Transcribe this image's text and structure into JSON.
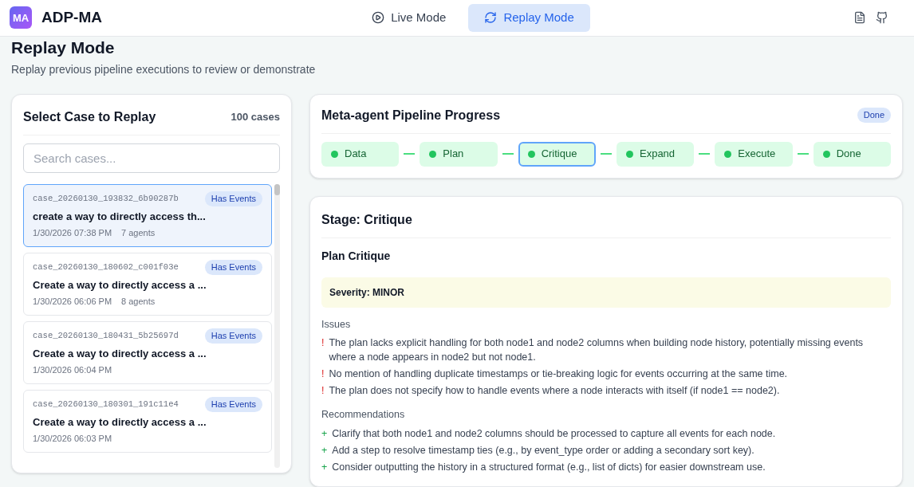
{
  "app": {
    "logo": "MA",
    "name": "ADP-MA"
  },
  "modes": [
    {
      "label": "Live Mode",
      "kind": "live",
      "selected": false
    },
    {
      "label": "Replay Mode",
      "kind": "replay",
      "selected": true
    }
  ],
  "page": {
    "title": "Replay Mode",
    "subtitle": "Replay previous pipeline executions to review or demonstrate"
  },
  "cases_panel": {
    "title": "Select Case to Replay",
    "count": "100 cases",
    "search": {
      "placeholder": "Search cases..."
    },
    "cases": [
      {
        "id": "case_20260130_193832_6b90287b",
        "badge": "Has Events",
        "title": "create a way to directly access th...",
        "time": "1/30/2026 07:38 PM",
        "agents": "7 agents",
        "selected": true
      },
      {
        "id": "case_20260130_180602_c001f03e",
        "badge": "Has Events",
        "title": "Create a way to directly access a ...",
        "time": "1/30/2026 06:06 PM",
        "agents": "8 agents",
        "selected": false
      },
      {
        "id": "case_20260130_180431_5b25697d",
        "badge": "Has Events",
        "title": "Create a way to directly access a ...",
        "time": "1/30/2026 06:04 PM",
        "selected": false
      },
      {
        "id": "case_20260130_180301_191c11e4",
        "badge": "Has Events",
        "title": "Create a way to directly access a ...",
        "time": "1/30/2026 06:03 PM",
        "selected": false
      }
    ]
  },
  "pipeline": {
    "title": "Meta-agent Pipeline Progress",
    "status": "Done",
    "stages": [
      {
        "label": "Data",
        "selected": false
      },
      {
        "label": "Plan",
        "selected": false
      },
      {
        "label": "Critique",
        "selected": true
      },
      {
        "label": "Expand",
        "selected": false
      },
      {
        "label": "Execute",
        "selected": false
      },
      {
        "label": "Done",
        "selected": false
      }
    ]
  },
  "stage_detail": {
    "title": "Stage: Critique",
    "subtitle": "Plan Critique",
    "severity": "Severity: MINOR",
    "sections": [
      {
        "heading": "Issues",
        "kind": "issue",
        "items": [
          {
            "mark": "!",
            "text": "The plan lacks explicit handling for both node1 and node2 columns when building node history, potentially missing events where a node appears in node2 but not node1."
          },
          {
            "mark": "!",
            "text": "No mention of handling duplicate timestamps or tie-breaking logic for events occurring at the same time."
          },
          {
            "mark": "!",
            "text": "The plan does not specify how to handle events where a node interacts with itself (if node1 == node2)."
          }
        ]
      },
      {
        "heading": "Recommendations",
        "kind": "recommendation",
        "items": [
          {
            "mark": "+",
            "text": "Clarify that both node1 and node2 columns should be processed to capture all events for each node."
          },
          {
            "mark": "+",
            "text": "Add a step to resolve timestamp ties (e.g., by event_type order or adding a secondary sort key)."
          },
          {
            "mark": "+",
            "text": "Consider outputting the history in a structured format (e.g., list of dicts) for easier downstream use."
          }
        ]
      }
    ]
  }
}
